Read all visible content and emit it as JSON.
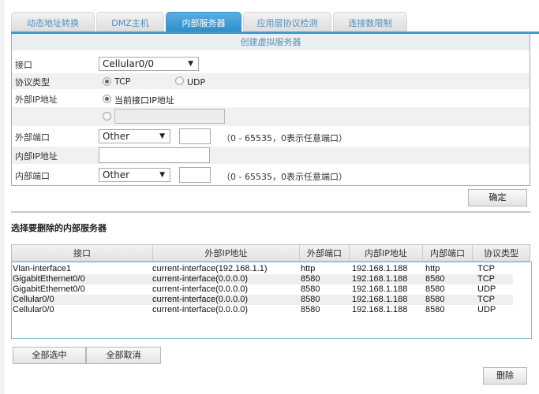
{
  "tabs": [
    {
      "label": "动态地址转换",
      "active": false
    },
    {
      "label": "DMZ主机",
      "active": false
    },
    {
      "label": "内部服务器",
      "active": true
    },
    {
      "label": "应用层协议检测",
      "active": false
    },
    {
      "label": "连接数限制",
      "active": false
    }
  ],
  "create_panel": {
    "title": "创建虚拟服务器",
    "interface": {
      "label": "接口",
      "value": "Cellular0/0"
    },
    "protocol": {
      "label": "协议类型",
      "options": [
        "TCP",
        "UDP"
      ],
      "selected": "TCP"
    },
    "external_ip": {
      "label": "外部IP地址",
      "option_current": "当前接口IP地址",
      "selected": "current",
      "custom_value": ""
    },
    "external_port": {
      "label": "外部端口",
      "select_value": "Other",
      "port_value": "",
      "hint": "（0 - 65535，0表示任意端口）"
    },
    "internal_ip": {
      "label": "内部IP地址",
      "value": ""
    },
    "internal_port": {
      "label": "内部端口",
      "select_value": "Other",
      "port_value": "",
      "hint": "（0 - 65535，0表示任意端口）"
    },
    "confirm_label": "确定"
  },
  "delete_section": {
    "title": "选择要删除的内部服务器",
    "columns": [
      "接口",
      "外部IP地址",
      "外部端口",
      "内部IP地址",
      "内部端口",
      "协议类型"
    ],
    "rows": [
      [
        "Vlan-interface1",
        "current-interface(192.168.1.1)",
        "http",
        "192.168.1.188",
        "http",
        "TCP"
      ],
      [
        "GigabitEthernet0/0",
        "current-interface(0.0.0.0)",
        "8580",
        "192.168.1.188",
        "8580",
        "TCP"
      ],
      [
        "GigabitEthernet0/0",
        "current-interface(0.0.0.0)",
        "8580",
        "192.168.1.188",
        "8580",
        "UDP"
      ],
      [
        "Cellular0/0",
        "current-interface(0.0.0.0)",
        "8580",
        "192.168.1.188",
        "8580",
        "TCP"
      ],
      [
        "Cellular0/0",
        "current-interface(0.0.0.0)",
        "8580",
        "192.168.1.188",
        "8580",
        "UDP"
      ]
    ],
    "select_all_label": "全部选中",
    "deselect_all_label": "全部取消",
    "delete_label": "删除"
  },
  "icons": {
    "dropdown": "▼"
  }
}
